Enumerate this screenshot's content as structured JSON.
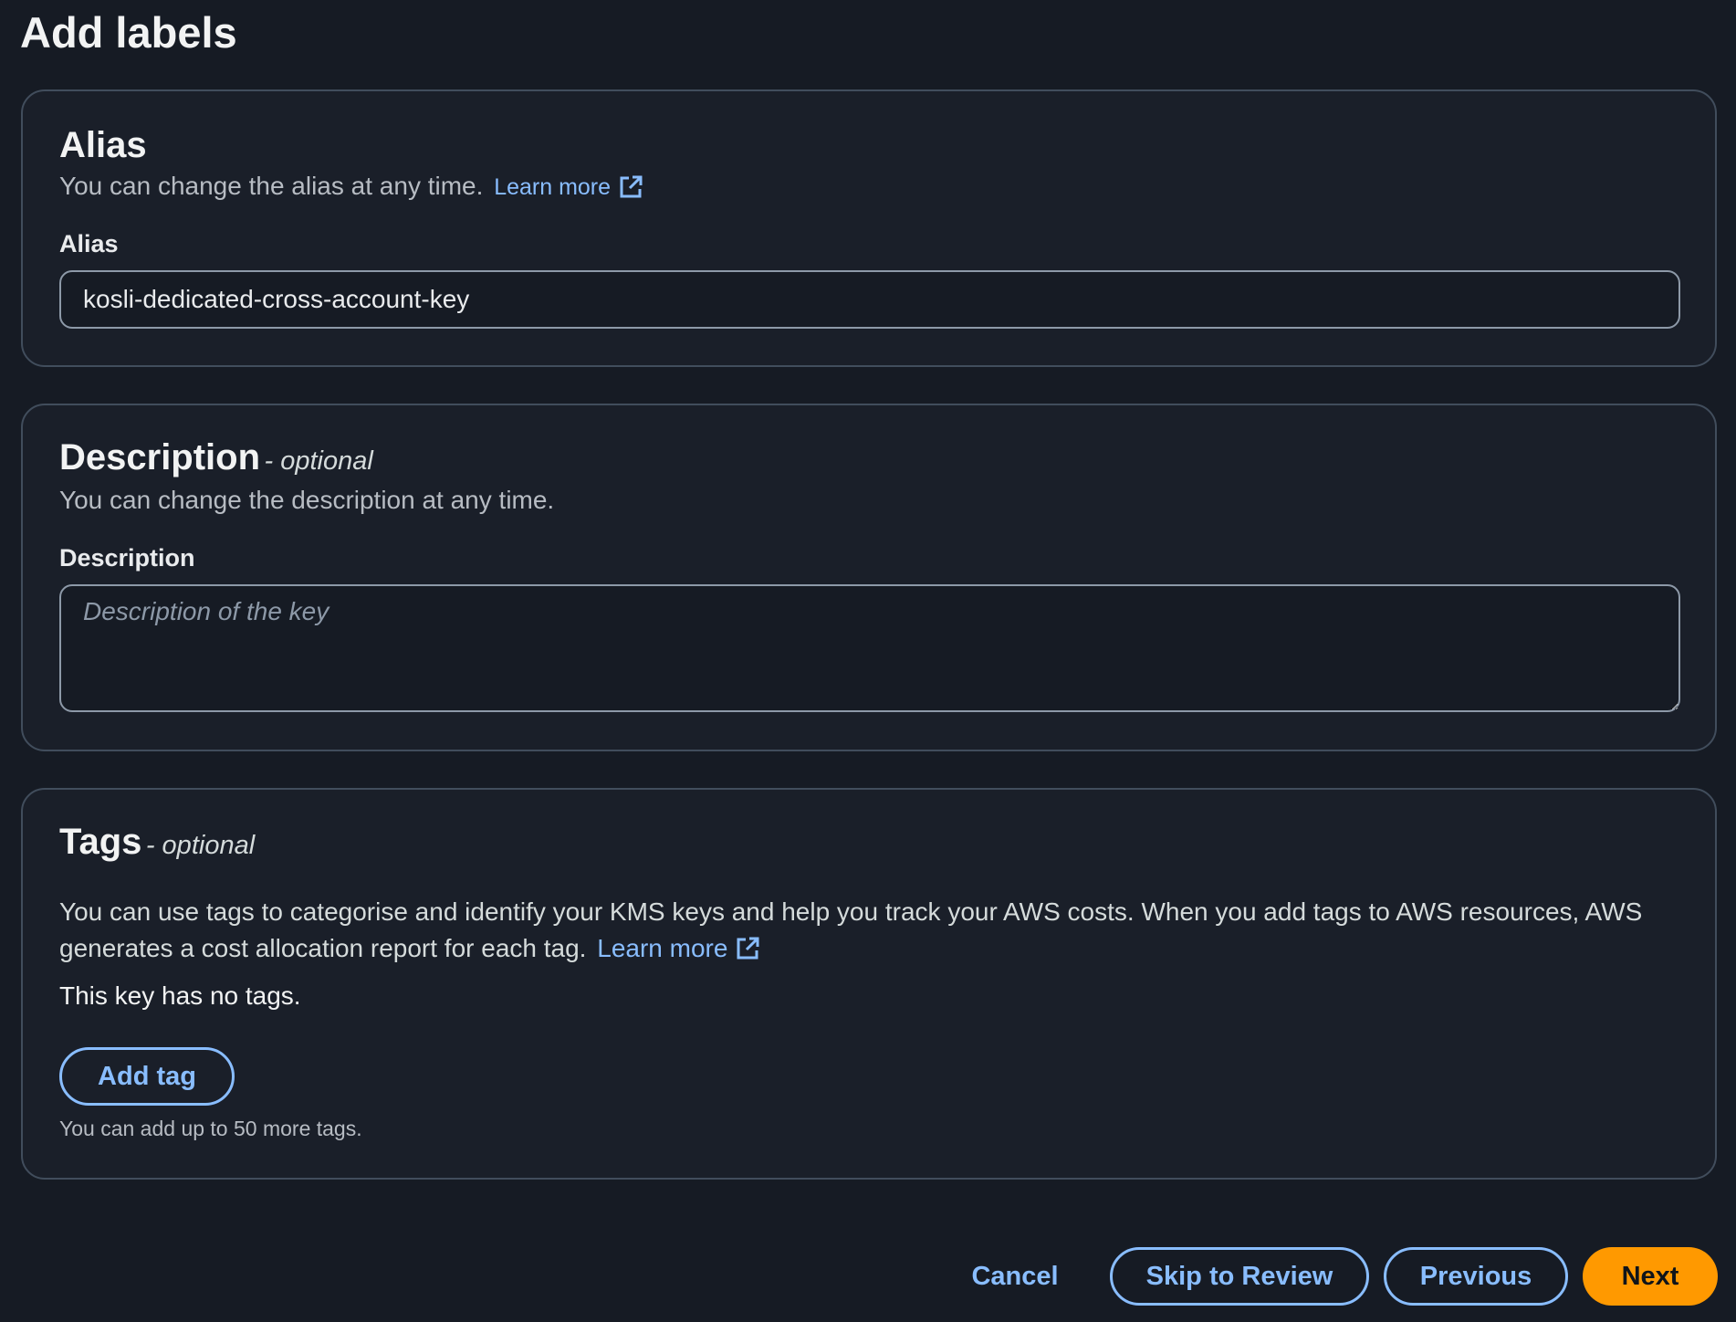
{
  "page": {
    "title": "Add labels"
  },
  "alias_panel": {
    "heading": "Alias",
    "description": "You can change the alias at any time.",
    "learn_more": "Learn more",
    "field_label": "Alias",
    "field_value": "kosli-dedicated-cross-account-key"
  },
  "description_panel": {
    "heading": "Description",
    "optional": "- optional",
    "description": "You can change the description at any time.",
    "field_label": "Description",
    "field_value": "",
    "placeholder": "Description of the key"
  },
  "tags_panel": {
    "heading": "Tags",
    "optional": "- optional",
    "description_line1": "You can use tags to categorise and identify your KMS keys and help you track your AWS costs. When you add tags to AWS resources, AWS",
    "description_line2": "generates a cost allocation report for each tag.",
    "learn_more": "Learn more",
    "empty_state": "This key has no tags.",
    "add_tag_label": "Add tag",
    "limit_hint": "You can add up to 50 more tags."
  },
  "footer": {
    "cancel_label": "Cancel",
    "skip_label": "Skip to Review",
    "previous_label": "Previous",
    "next_label": "Next"
  },
  "colors": {
    "background": "#161b24",
    "panel": "#1a1f29",
    "link": "#89bdff",
    "primary": "#ff9900"
  },
  "icons": {
    "external_link": "external-link-icon"
  }
}
